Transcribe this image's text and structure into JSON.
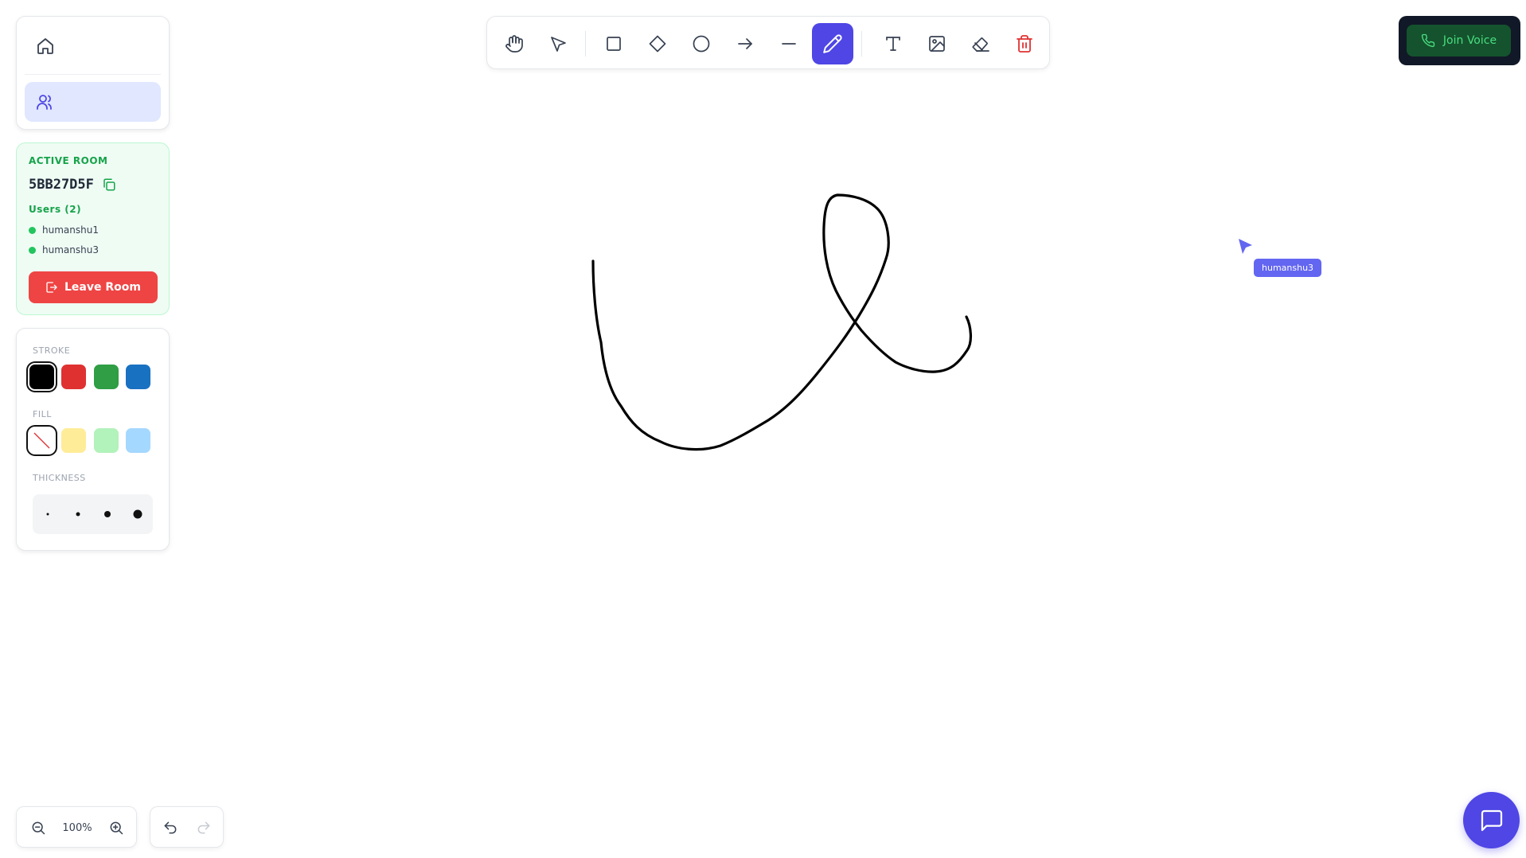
{
  "room": {
    "heading": "Active Room",
    "id": "5BB27D5F",
    "users_heading": "Users (2)",
    "users": [
      "humanshu1",
      "humanshu3"
    ],
    "leave_label": "Leave Room"
  },
  "style_panel": {
    "stroke_label": "Stroke",
    "fill_label": "Fill",
    "thickness_label": "Thickness",
    "stroke_colors": [
      "#000000",
      "#e03131",
      "#2f9e44",
      "#1971c2"
    ],
    "fill_colors": [
      "transparent",
      "#ffec99",
      "#b2f2bb",
      "#a5d8ff"
    ],
    "selected_stroke": "#000000",
    "selected_fill": "transparent"
  },
  "toolbar": {
    "tools": [
      "hand",
      "select",
      "rectangle",
      "diamond",
      "ellipse",
      "arrow",
      "line",
      "pencil",
      "text",
      "image",
      "eraser",
      "delete"
    ],
    "active_tool": "pencil"
  },
  "voice": {
    "join_label": "Join Voice"
  },
  "remote_cursor": {
    "user": "humanshu3",
    "color": "#6366f1"
  },
  "zoom": {
    "level": "100%"
  },
  "colors": {
    "accent": "#4f46e5",
    "danger": "#ef4444",
    "success": "#16a34a"
  }
}
